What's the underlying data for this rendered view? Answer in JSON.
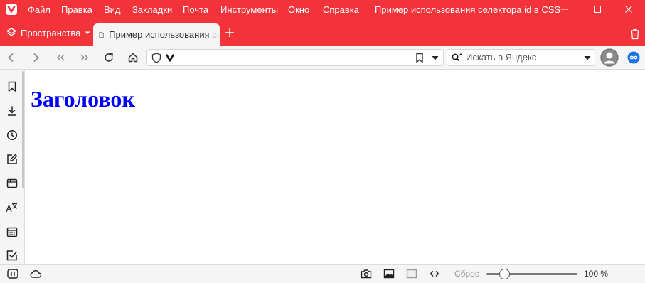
{
  "menu": {
    "items": [
      "Файл",
      "Правка",
      "Вид",
      "Закладки",
      "Почта",
      "Инструменты",
      "Окно",
      "Справка"
    ],
    "window_title": "Пример использования селектора id в CSS"
  },
  "tabs": {
    "spaces_label": "Пространства",
    "active_tab_title": "Пример использования селектора id в CSS"
  },
  "addressbar": {
    "url": "",
    "search_placeholder": "Искать в Яндекс"
  },
  "page": {
    "heading": "Заголовок"
  },
  "statusbar": {
    "reset_label": "Сброс",
    "zoom_label": "100 %",
    "zoom_level": 0.2
  },
  "colors": {
    "brand": "#f2333a",
    "heading": "#0000ff",
    "accent": "#1a73e8"
  }
}
